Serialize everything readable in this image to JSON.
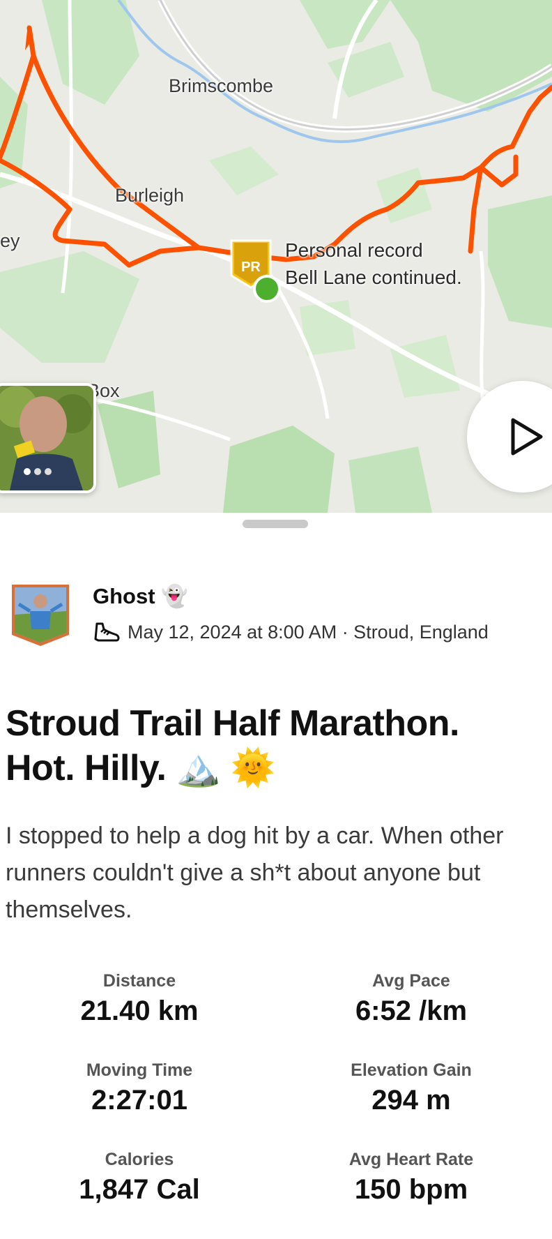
{
  "map": {
    "places": {
      "brimscombe": "Brimscombe",
      "burleigh": "Burleigh",
      "partial_left": "ey",
      "box": "Box"
    },
    "pr_badge": "PR",
    "pr_title": "Personal record",
    "pr_segment": "Bell Lane continued.",
    "route_color": "#fc5200",
    "start_color": "#4caf2e"
  },
  "athlete": {
    "name": "Ghost",
    "name_emoji": "👻",
    "sport_icon": "shoe-icon",
    "meta": "May 12, 2024 at 8:00 AM · Stroud, England"
  },
  "activity": {
    "title_line1": "Stroud Trail Half Marathon.",
    "title_line2": "Hot. Hilly.",
    "title_emoji": "🏔️ 🌞",
    "description": "I stopped to help a dog hit by a car. When other runners couldn't give a sh*t about anyone but themselves."
  },
  "stats": {
    "distance": {
      "label": "Distance",
      "value": "21.40 km"
    },
    "avg_pace": {
      "label": "Avg Pace",
      "value": "6:52 /km"
    },
    "moving_time": {
      "label": "Moving Time",
      "value": "2:27:01"
    },
    "elevation_gain": {
      "label": "Elevation Gain",
      "value": "294 m"
    },
    "calories": {
      "label": "Calories",
      "value": "1,847 Cal"
    },
    "avg_heart_rate": {
      "label": "Avg Heart Rate",
      "value": "150 bpm"
    }
  }
}
